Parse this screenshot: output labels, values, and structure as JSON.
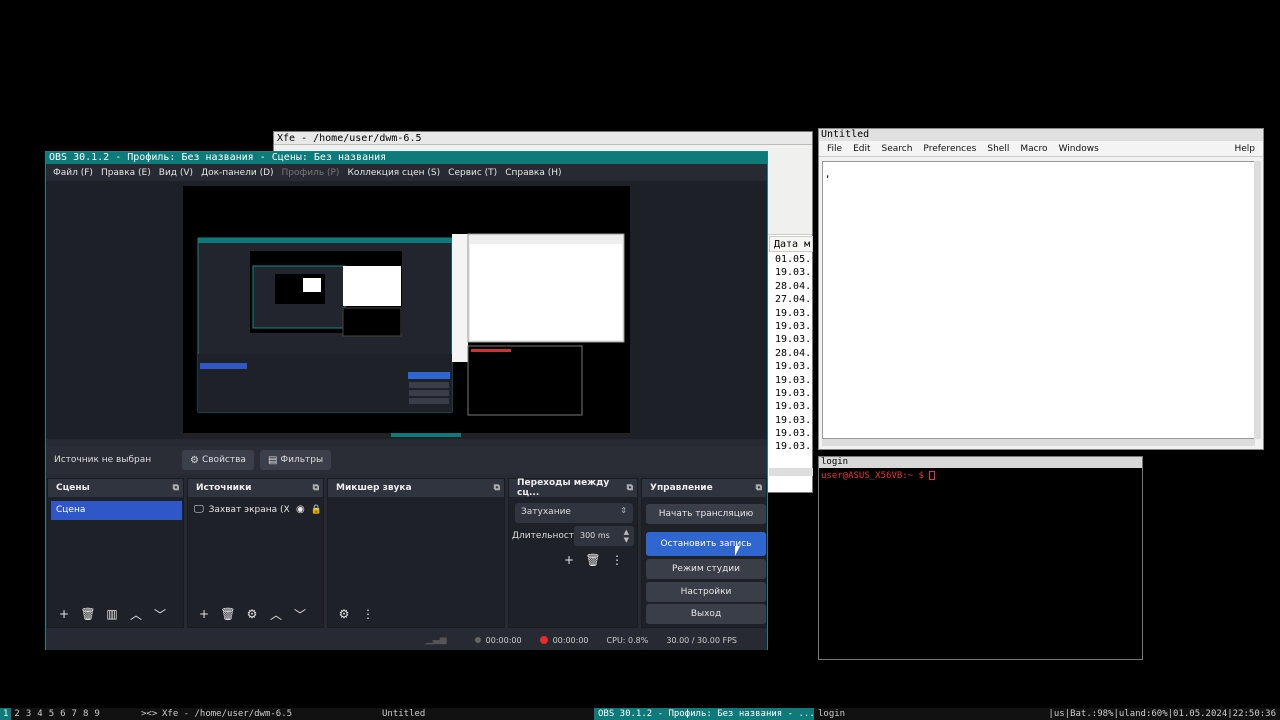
{
  "xfe": {
    "title": "Xfe - /home/user/dwm-6.5",
    "date_header": "Дата м",
    "dates": [
      "01.05.",
      "19.03.",
      "28.04.",
      "27.04.",
      "19.03.",
      "19.03.",
      "19.03.",
      "28.04.",
      "19.03.",
      "19.03.",
      "19.03.",
      "19.03.",
      "19.03.",
      "19.03.",
      "19.03."
    ]
  },
  "nedit": {
    "title": "Untitled",
    "menu": [
      "File",
      "Edit",
      "Search",
      "Preferences",
      "Shell",
      "Macro",
      "Windows"
    ],
    "help": "Help",
    "content": ","
  },
  "terminal": {
    "title": "login",
    "prompt": "user@ASUS_X56VB:~ $ "
  },
  "obs": {
    "title": "OBS 30.1.2 - Профиль: Без названия - Сцены: Без названия",
    "menu": [
      {
        "label": "Файл (F)",
        "enabled": true
      },
      {
        "label": "Правка (E)",
        "enabled": true
      },
      {
        "label": "Вид (V)",
        "enabled": true
      },
      {
        "label": "Док-панели (D)",
        "enabled": true
      },
      {
        "label": "Профиль (P)",
        "enabled": false
      },
      {
        "label": "Коллекция сцен (S)",
        "enabled": true
      },
      {
        "label": "Сервис (T)",
        "enabled": true
      },
      {
        "label": "Справка (H)",
        "enabled": true
      }
    ],
    "source_bar": {
      "no_source": "Источник не выбран",
      "properties": "Свойства",
      "filters": "Фильтры"
    },
    "docks": {
      "scenes": {
        "title": "Сцены",
        "items": [
          "Сцена"
        ]
      },
      "sources": {
        "title": "Источники",
        "items": [
          {
            "name": "Захват экрана (X"
          }
        ]
      },
      "mixer": {
        "title": "Микшер звука"
      },
      "transitions": {
        "title": "Переходы между сц...",
        "selected": "Затухание",
        "duration_label": "Длительность",
        "duration_value": "300 ms"
      },
      "controls": {
        "title": "Управление",
        "buttons": [
          "Начать трансляцию",
          "Остановить запись",
          "Режим студии",
          "Настройки",
          "Выход"
        ]
      }
    },
    "status": {
      "stream_time": "00:00:00",
      "rec_time": "00:00:00",
      "cpu": "CPU: 0.8%",
      "fps": "30.00 / 30.00 FPS"
    },
    "colors": {
      "accent": "#2f66d0",
      "title_bar": "#0e7a7a",
      "record": "#e52a2a"
    }
  },
  "taskbar": {
    "workspaces": [
      "1",
      "2",
      "3",
      "4",
      "5",
      "6",
      "7",
      "8",
      "9"
    ],
    "current_workspace": "1",
    "layout": "><>",
    "tasks": [
      "Xfe - /home/user/dwm-6.5",
      "Untitled",
      "OBS 30.1.2 - Профиль: Без названия - ...",
      "login"
    ],
    "status": "|us|Bat.:98%|uland:60%|01.05.2024|22:50:36"
  }
}
